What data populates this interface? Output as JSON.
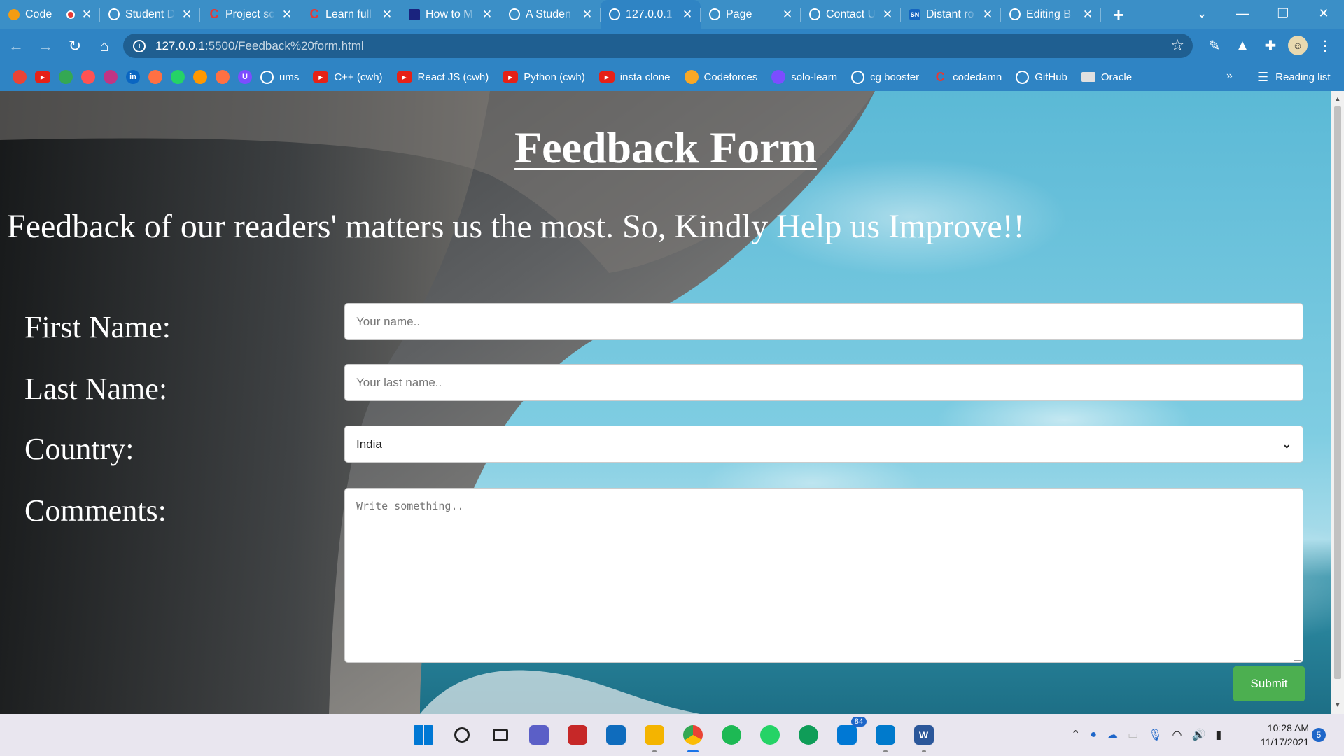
{
  "tabs": [
    {
      "title": "Code",
      "favicon": "code-icon",
      "color": "#f39c12",
      "recording": true
    },
    {
      "title": "Student D",
      "favicon": "globe-icon",
      "color": "#ffffff"
    },
    {
      "title": "Project sc",
      "favicon": "codedamn-icon",
      "color": "#e53935"
    },
    {
      "title": "Learn full",
      "favicon": "codedamn-icon",
      "color": "#e53935"
    },
    {
      "title": "How to M",
      "favicon": "wikihow-icon",
      "color": "#1a237e"
    },
    {
      "title": "A Studen",
      "favicon": "globe-icon",
      "color": "#ffffff"
    },
    {
      "title": "127.0.0.1",
      "favicon": "globe-icon",
      "color": "#ffffff",
      "active": true
    },
    {
      "title": "Page",
      "favicon": "globe-icon",
      "color": "#ffffff"
    },
    {
      "title": "Contact U",
      "favicon": "globe-icon",
      "color": "#ffffff"
    },
    {
      "title": "Distant ro",
      "favicon": "sn-icon",
      "color": "#1565c0",
      "favicon_text": "SN"
    },
    {
      "title": "Editing B",
      "favicon": "github-icon",
      "color": "#ffffff"
    }
  ],
  "address": {
    "host": "127.0.0.1",
    "path": ":5500/Feedback%20form.html"
  },
  "bookmarks": [
    {
      "label": "",
      "icon": "gmail-icon",
      "color": "#ea4335"
    },
    {
      "label": "",
      "icon": "youtube-icon",
      "color": "#e62117"
    },
    {
      "label": "",
      "icon": "drive-icon",
      "color": "#34a853"
    },
    {
      "label": "",
      "icon": "speedometer-icon",
      "color": "#ff5252"
    },
    {
      "label": "",
      "icon": "instagram-icon",
      "color": "#c13584"
    },
    {
      "label": "",
      "icon": "linkedin-icon",
      "color": "#0a66c2",
      "text": "in"
    },
    {
      "label": "",
      "icon": "basketball-icon",
      "color": "#ff7043"
    },
    {
      "label": "",
      "icon": "whatsapp-icon",
      "color": "#25d366"
    },
    {
      "label": "",
      "icon": "sun-icon",
      "color": "#ff9800"
    },
    {
      "label": "",
      "icon": "orange-icon",
      "color": "#ff7043"
    },
    {
      "label": "",
      "icon": "purple-u-icon",
      "color": "#7c4dff",
      "text": "U"
    },
    {
      "label": "ums",
      "icon": "globe-icon",
      "color": "#ffffff"
    },
    {
      "label": "C++ (cwh)",
      "icon": "youtube-icon",
      "color": "#e62117"
    },
    {
      "label": "React JS (cwh)",
      "icon": "youtube-icon",
      "color": "#e62117"
    },
    {
      "label": "Python (cwh)",
      "icon": "youtube-icon",
      "color": "#e62117"
    },
    {
      "label": "insta clone",
      "icon": "youtube-icon",
      "color": "#e62117"
    },
    {
      "label": "Codeforces",
      "icon": "codeforces-icon",
      "color": "#f9a825"
    },
    {
      "label": "solo-learn",
      "icon": "sololearn-icon",
      "color": "#7c4dff"
    },
    {
      "label": "cg booster",
      "icon": "globe-icon",
      "color": "#ffffff"
    },
    {
      "label": "codedamn",
      "icon": "codedamn-icon",
      "color": "#e53935"
    },
    {
      "label": "GitHub",
      "icon": "github-icon",
      "color": "#ffffff"
    },
    {
      "label": "Oracle",
      "icon": "folder-icon",
      "color": "#ffffff"
    }
  ],
  "bookmarks_overflow": "»",
  "reading_list": "Reading list",
  "page": {
    "heading": "Feedback Form",
    "subheading": "Feedback of our readers' matters us the most. So, Kindly Help us Improve!!",
    "labels": {
      "first_name": "First Name:",
      "last_name": "Last Name:",
      "country": "Country:",
      "comments": "Comments:"
    },
    "placeholders": {
      "first_name": "Your name..",
      "last_name": "Your last name..",
      "comments": "Write something.."
    },
    "country_selected": "India",
    "submit": "Submit"
  },
  "taskbar": {
    "apps": [
      {
        "name": "windows-start-icon",
        "color": "#0078d4"
      },
      {
        "name": "search-icon",
        "color": "#222222"
      },
      {
        "name": "task-view-icon",
        "color": "#222222"
      },
      {
        "name": "teams-chat-icon",
        "color": "#5b5fc7"
      },
      {
        "name": "mcafee-icon",
        "color": "#c62828"
      },
      {
        "name": "mail-icon",
        "color": "#0f6cbd"
      },
      {
        "name": "file-explorer-icon",
        "color": "#f4b400"
      },
      {
        "name": "chrome-icon",
        "color": "#4285f4",
        "active": true
      },
      {
        "name": "spotify-icon",
        "color": "#1db954"
      },
      {
        "name": "whatsapp-icon",
        "color": "#25d366"
      },
      {
        "name": "edge-icon",
        "color": "#0f9d58"
      },
      {
        "name": "outlook-icon",
        "color": "#0078d4",
        "badge": "84"
      },
      {
        "name": "vscode-icon",
        "color": "#007acc"
      },
      {
        "name": "word-icon",
        "color": "#2b579a",
        "text": "W"
      }
    ],
    "time": "10:28 AM",
    "date": "11/17/2021",
    "notifications": "5"
  }
}
